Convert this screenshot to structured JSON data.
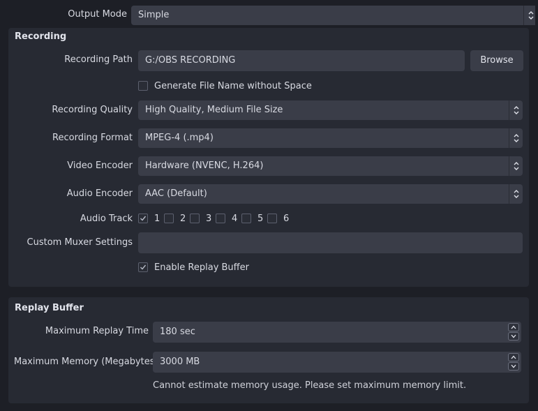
{
  "output_mode": {
    "label": "Output Mode",
    "value": "Simple"
  },
  "recording": {
    "title": "Recording",
    "path_label": "Recording Path",
    "path_value": "G:/OBS RECORDING",
    "browse_label": "Browse",
    "gen_filename_label": "Generate File Name without Space",
    "quality_label": "Recording Quality",
    "quality_value": "High Quality, Medium File Size",
    "format_label": "Recording Format",
    "format_value": "MPEG-4 (.mp4)",
    "video_encoder_label": "Video Encoder",
    "video_encoder_value": "Hardware (NVENC, H.264)",
    "audio_encoder_label": "Audio Encoder",
    "audio_encoder_value": "AAC (Default)",
    "audio_track_label": "Audio Track",
    "tracks": [
      "1",
      "2",
      "3",
      "4",
      "5",
      "6"
    ],
    "tracks_checked": [
      true,
      false,
      false,
      false,
      false,
      false
    ],
    "muxer_label": "Custom Muxer Settings",
    "muxer_value": "",
    "replay_enable_label": "Enable Replay Buffer",
    "replay_enabled": true,
    "gen_filename_checked": false
  },
  "replay": {
    "title": "Replay Buffer",
    "max_time_label": "Maximum Replay Time",
    "max_time_value": "180 sec",
    "max_memory_label": "Maximum Memory (Megabytes)",
    "max_memory_value": "3000 MB",
    "note": "Cannot estimate memory usage. Please set maximum memory limit."
  },
  "colors": {
    "background": "#1d1f26",
    "panel": "#272a33",
    "control": "#3a3d48",
    "text": "#d8dae2"
  }
}
